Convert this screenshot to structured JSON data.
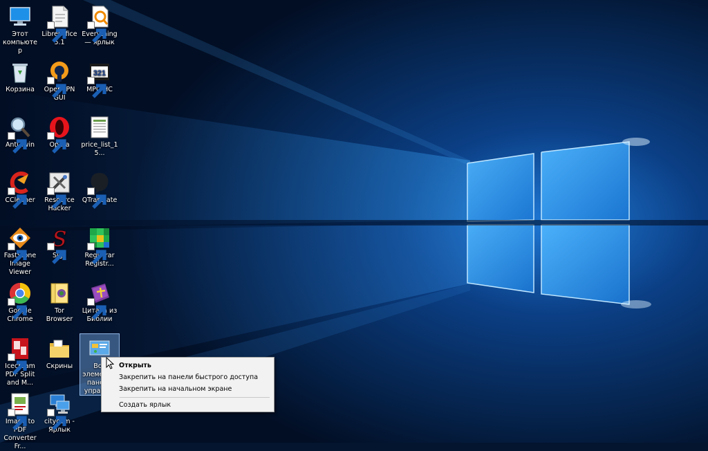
{
  "desktop": {
    "icons": [
      {
        "label": "Этот компьютер",
        "icon": "computer-icon",
        "shortcut": false
      },
      {
        "label": "LibreOffice 5.1",
        "icon": "libreoffice-icon",
        "shortcut": true
      },
      {
        "label": "Everything — ярлык",
        "icon": "everything-icon",
        "shortcut": true
      },
      {
        "label": "Корзина",
        "icon": "recycle-bin-icon",
        "shortcut": false
      },
      {
        "label": "OpenVPN GUI",
        "icon": "openvpn-icon",
        "shortcut": true
      },
      {
        "label": "MPC-HC",
        "icon": "mpc-hc-icon",
        "shortcut": true
      },
      {
        "label": "Anti-Twin",
        "icon": "anti-twin-icon",
        "shortcut": true
      },
      {
        "label": "Opera",
        "icon": "opera-icon",
        "shortcut": true
      },
      {
        "label": "price_list_15...",
        "icon": "spreadsheet-icon",
        "shortcut": false
      },
      {
        "label": "CCleaner",
        "icon": "ccleaner-icon",
        "shortcut": true
      },
      {
        "label": "Resource Hacker",
        "icon": "resource-hacker-icon",
        "shortcut": true
      },
      {
        "label": "QTranslate",
        "icon": "qtranslate-icon",
        "shortcut": true
      },
      {
        "label": "FastStone Image Viewer",
        "icon": "faststone-icon",
        "shortcut": true
      },
      {
        "label": "Sigil",
        "icon": "sigil-icon",
        "shortcut": true
      },
      {
        "label": "Registrar Registr...",
        "icon": "registrar-icon",
        "shortcut": true
      },
      {
        "label": "Google Chrome",
        "icon": "chrome-icon",
        "shortcut": true
      },
      {
        "label": "Tor Browser",
        "icon": "tor-browser-icon",
        "shortcut": false
      },
      {
        "label": "Цитата из Библии",
        "icon": "bible-quote-icon",
        "shortcut": true
      },
      {
        "label": "Icecream PDF Split and M...",
        "icon": "icecream-pdf-icon",
        "shortcut": true
      },
      {
        "label": "Скрины",
        "icon": "folder-icon",
        "shortcut": false
      },
      {
        "label": "Все элементы панели управл...",
        "icon": "control-panel-icon",
        "shortcut": false
      },
      {
        "label": "Image to PDF Converter Fr...",
        "icon": "image-to-pdf-icon",
        "shortcut": true
      },
      {
        "label": "citycom - Ярлык",
        "icon": "network-computer-icon",
        "shortcut": true
      }
    ],
    "selected_icon_index": 20
  },
  "context_menu": {
    "items": [
      {
        "label": "Открыть",
        "bold": true
      },
      {
        "label": "Закрепить на панели быстрого доступа",
        "bold": false
      },
      {
        "label": "Закрепить на начальном экране",
        "bold": false
      },
      {
        "label": "Создать ярлык",
        "bold": false
      }
    ]
  },
  "colors": {
    "wallpaper_dark": "#03152f",
    "wallpaper_mid": "#0a3d7a",
    "wallpaper_light": "#38a4f0",
    "menu_background": "#f2f2f2",
    "selection": "#78aae6"
  }
}
